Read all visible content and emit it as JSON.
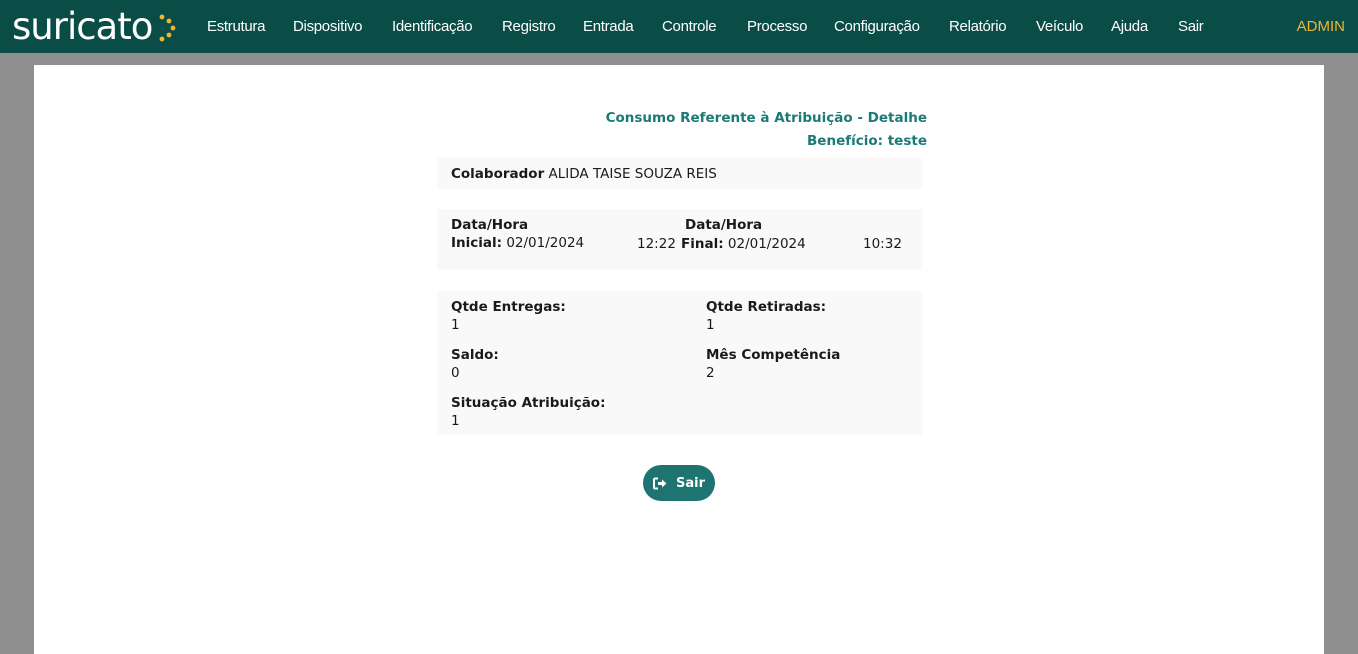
{
  "header": {
    "logo_text": "suricato",
    "nav_items": [
      "Estrutura",
      "Dispositivo",
      "Identificação",
      "Registro",
      "Entrada",
      "Controle",
      "Processo",
      "Configuração",
      "Relatório",
      "Veículo",
      "Ajuda",
      "Sair"
    ],
    "user": "ADMIN"
  },
  "page": {
    "title": "Consumo Referente à Atribuição - Detalhe",
    "subtitle": "Benefício: teste"
  },
  "collaborator": {
    "label": "Colaborador",
    "value": "ALIDA TAISE SOUZA REIS"
  },
  "period": {
    "start_label_line1": "Data/Hora",
    "start_label_line2": "Inicial:",
    "start_date": "02/01/2024",
    "start_time": "12:22",
    "end_label_line1": "Data/Hora",
    "end_label_line2": "Final:",
    "end_date": "02/01/2024",
    "end_time": "10:32"
  },
  "details": {
    "deliveries_label": "Qtde Entregas:",
    "deliveries_value": "1",
    "withdrawals_label": "Qtde Retiradas:",
    "withdrawals_value": "1",
    "balance_label": "Saldo:",
    "balance_value": "0",
    "month_label": "Mês Competência",
    "month_value": "2",
    "status_label": "Situação Atribuição:",
    "status_value": "1"
  },
  "actions": {
    "exit_label": "Sair"
  },
  "colors": {
    "navbar": "#0a4d47",
    "accent": "#1a7a76",
    "user": "#f1b531",
    "logo_dots": "#f1b531"
  }
}
